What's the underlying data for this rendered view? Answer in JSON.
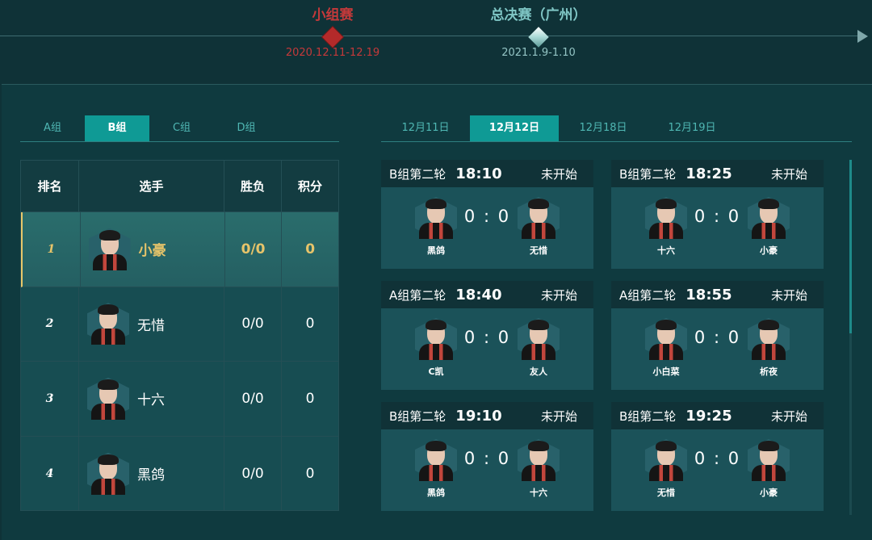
{
  "timeline": {
    "stages": [
      {
        "name": "小组赛",
        "date": "2020.12.11-12.19",
        "active": true
      },
      {
        "name": "总决赛（广州）",
        "date": "2021.1.9-1.10",
        "active": false
      }
    ]
  },
  "group_tabs": [
    "A组",
    "B组",
    "C组",
    "D组"
  ],
  "group_tabs_active": "B组",
  "date_tabs": [
    "12月11日",
    "12月12日",
    "12月18日",
    "12月19日"
  ],
  "date_tabs_active": "12月12日",
  "standings": {
    "headers": {
      "rank": "排名",
      "player": "选手",
      "wl": "胜负",
      "points": "积分"
    },
    "rows": [
      {
        "rank": "1",
        "name": "小豪",
        "wl": "0/0",
        "points": "0"
      },
      {
        "rank": "2",
        "name": "无惜",
        "wl": "0/0",
        "points": "0"
      },
      {
        "rank": "3",
        "name": "十六",
        "wl": "0/0",
        "points": "0"
      },
      {
        "rank": "4",
        "name": "黑鸽",
        "wl": "0/0",
        "points": "0"
      }
    ]
  },
  "matches": [
    {
      "round": "B组第二轮",
      "time": "18:10",
      "status": "未开始",
      "p1": "黑鸽",
      "p2": "无惜",
      "score": "0 : 0"
    },
    {
      "round": "B组第二轮",
      "time": "18:25",
      "status": "未开始",
      "p1": "十六",
      "p2": "小豪",
      "score": "0 : 0"
    },
    {
      "round": "A组第二轮",
      "time": "18:40",
      "status": "未开始",
      "p1": "C凯",
      "p2": "友人",
      "score": "0 : 0"
    },
    {
      "round": "A组第二轮",
      "time": "18:55",
      "status": "未开始",
      "p1": "小白菜",
      "p2": "析夜",
      "score": "0 : 0"
    },
    {
      "round": "B组第二轮",
      "time": "19:10",
      "status": "未开始",
      "p1": "黑鸽",
      "p2": "十六",
      "score": "0 : 0"
    },
    {
      "round": "B组第二轮",
      "time": "19:25",
      "status": "未开始",
      "p1": "无惜",
      "p2": "小豪",
      "score": "0 : 0"
    }
  ],
  "colors": {
    "active_stage": "#c5393a",
    "accent": "#0f9a95",
    "highlight": "#e7c46a"
  }
}
